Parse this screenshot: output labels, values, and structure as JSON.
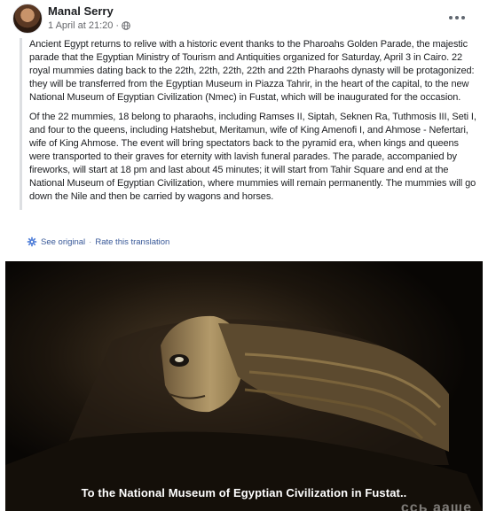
{
  "post": {
    "author": "Manal Serry",
    "timestamp": "1 April at 21:20",
    "meta_separator": "·",
    "privacy_icon": "globe-icon",
    "more_icon": "more-options-icon"
  },
  "translation": {
    "paragraphs": [
      "Ancient Egypt returns to relive with a historic event thanks to the Pharoahs Golden Parade, the majestic parade that the Egyptian Ministry of Tourism and Antiquities organized for Saturday, April 3 in Cairo. 22 royal mummies dating back to the 22th, 22th, 22th, 22th and 22th Pharaohs dynasty will be protagonized: they will be transferred from the Egyptian Museum in Piazza Tahrir, in the heart of the capital, to the new National Museum of Egyptian Civilization (Nmec) in Fustat, which will be inaugurated for the occasion.",
      "Of the 22 mummies, 18 belong to pharaohs, including Ramses II, Siptah, Seknen Ra, Tuthmosis III, Seti I, and four to the queens, including Hatshebut, Meritamun, wife of King Amenofi I, and Ahmose - Nefertari, wife of King Ahmose. The event will bring spectators back to the pyramid era, when kings and queens were transported to their graves for eternity with lavish funeral parades. The parade, accompanied by fireworks, will start at 18 pm and last about 45 minutes; it will start from Tahir Square and end at the National Museum of Egyptian Civilization, where mummies will remain permanently. The mummies will go down the Nile and then be carried by wagons and horses."
    ],
    "see_original": "See original",
    "separator": "·",
    "rate_translation": "Rate this translation",
    "icon": "translate-icon"
  },
  "media": {
    "subtitle": "To the National Museum of Egyptian Civilization in Fustat..",
    "watermark": "ссь ааше"
  },
  "colors": {
    "link": "#385898",
    "meta": "#65676b",
    "quote_bar": "#dddfe2"
  }
}
